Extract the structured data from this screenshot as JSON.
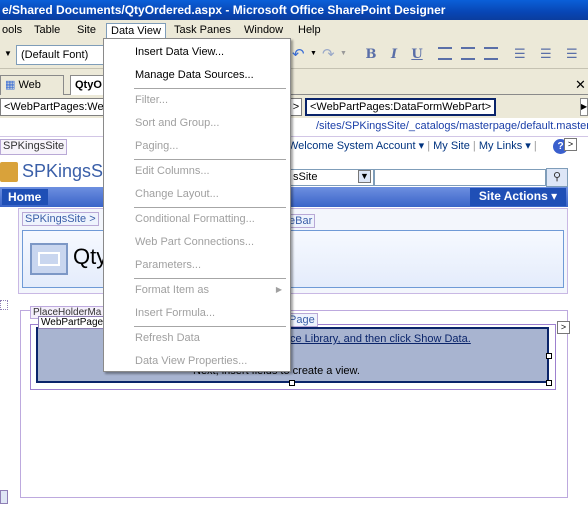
{
  "window": {
    "title": "e/Shared Documents/QtyOrdered.aspx - Microsoft Office SharePoint Designer"
  },
  "menubar": {
    "items": [
      "ools",
      "Table",
      "Site",
      "Data View",
      "Task Panes",
      "Window",
      "Help"
    ],
    "active": "Data View"
  },
  "toolbar": {
    "font": "(Default Font)",
    "bold": "B",
    "italic": "I",
    "underline": "U"
  },
  "tabs": {
    "website": "Web Site",
    "current": "QtyO"
  },
  "tagbar": {
    "left": "<WebPartPages:Wel",
    "right": "<WebPartPages:DataFormWebPart>",
    "mid_end": ">"
  },
  "design": {
    "path": "/sites/SPKingsSite/_catalogs/masterpage/default.master",
    "spk_label": "SPKingsSite",
    "welcome": "Welcome System Account ▾",
    "mysite": "My Site",
    "mylinks": "My Links ▾",
    "site_title": "SPKingsSi",
    "search_scope": "sSite",
    "home": "Home",
    "site_actions": "Site Actions ▾",
    "breadcrumb": "SPKingsSite >",
    "breadcrumb2": "eBar",
    "page_title": "Qty",
    "placeholder_tag": "PlaceHolderMa",
    "webpartpages_tag": "WebPartPage",
    "page_tag": "Page",
    "dfwp_line1": "ce Library, and then click Show Data.",
    "dfwp_line2": "Next, insert fields to create a view."
  },
  "data_view_menu": {
    "items": [
      {
        "label": "Insert Data View...",
        "enabled": true
      },
      {
        "label": "Manage Data Sources...",
        "enabled": true
      },
      {
        "label": "Filter...",
        "enabled": false
      },
      {
        "label": "Sort and Group...",
        "enabled": false
      },
      {
        "label": "Paging...",
        "enabled": false
      },
      {
        "label": "Edit Columns...",
        "enabled": false
      },
      {
        "label": "Change Layout...",
        "enabled": false
      },
      {
        "label": "Conditional Formatting...",
        "enabled": false
      },
      {
        "label": "Web Part Connections...",
        "enabled": false
      },
      {
        "label": "Parameters...",
        "enabled": false
      },
      {
        "label": "Format Item as",
        "enabled": false
      },
      {
        "label": "Insert Formula...",
        "enabled": false
      },
      {
        "label": "Refresh Data",
        "enabled": false
      },
      {
        "label": "Data View Properties...",
        "enabled": false
      }
    ]
  },
  "colors": {
    "titlebar": "#0846b5",
    "navbar": "#3a64c8",
    "dataform_bg": "#a8b4d0",
    "disabled_text": "#a0a0a0"
  }
}
